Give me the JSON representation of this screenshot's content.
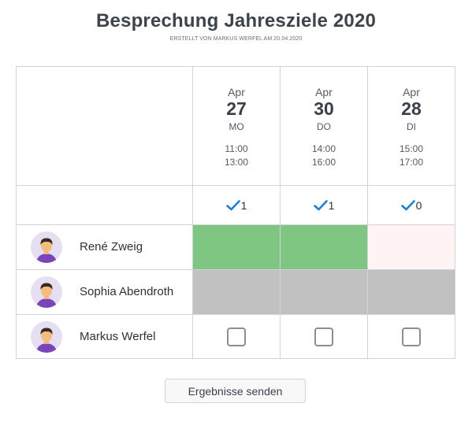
{
  "header": {
    "title": "Besprechung Jahresziele 2020",
    "subtitle": "ERSTELLT VON MARKUS WERFEL AM 20.04.2020"
  },
  "dates": [
    {
      "month": "Apr",
      "day": "27",
      "weekday": "MO",
      "start": "11:00",
      "end": "13:00",
      "count": "1"
    },
    {
      "month": "Apr",
      "day": "30",
      "weekday": "DO",
      "start": "14:00",
      "end": "16:00",
      "count": "1"
    },
    {
      "month": "Apr",
      "day": "28",
      "weekday": "DI",
      "start": "15:00",
      "end": "17:00",
      "count": "0"
    }
  ],
  "participants": [
    {
      "name": "René Zweig",
      "answers": [
        "yes",
        "yes",
        "maybe"
      ]
    },
    {
      "name": "Sophia Abendroth",
      "answers": [
        "none",
        "none",
        "none"
      ]
    },
    {
      "name": "Markus Werfel",
      "answers": [
        "checkbox",
        "checkbox",
        "checkbox"
      ]
    }
  ],
  "actions": {
    "submit_label": "Ergebnisse senden"
  },
  "colors": {
    "yes": "#80c683",
    "maybe": "#fff3f3",
    "none": "#c1c1c1",
    "check": "#1e7fd6"
  },
  "icons": [
    "check-icon",
    "avatar-icon"
  ]
}
